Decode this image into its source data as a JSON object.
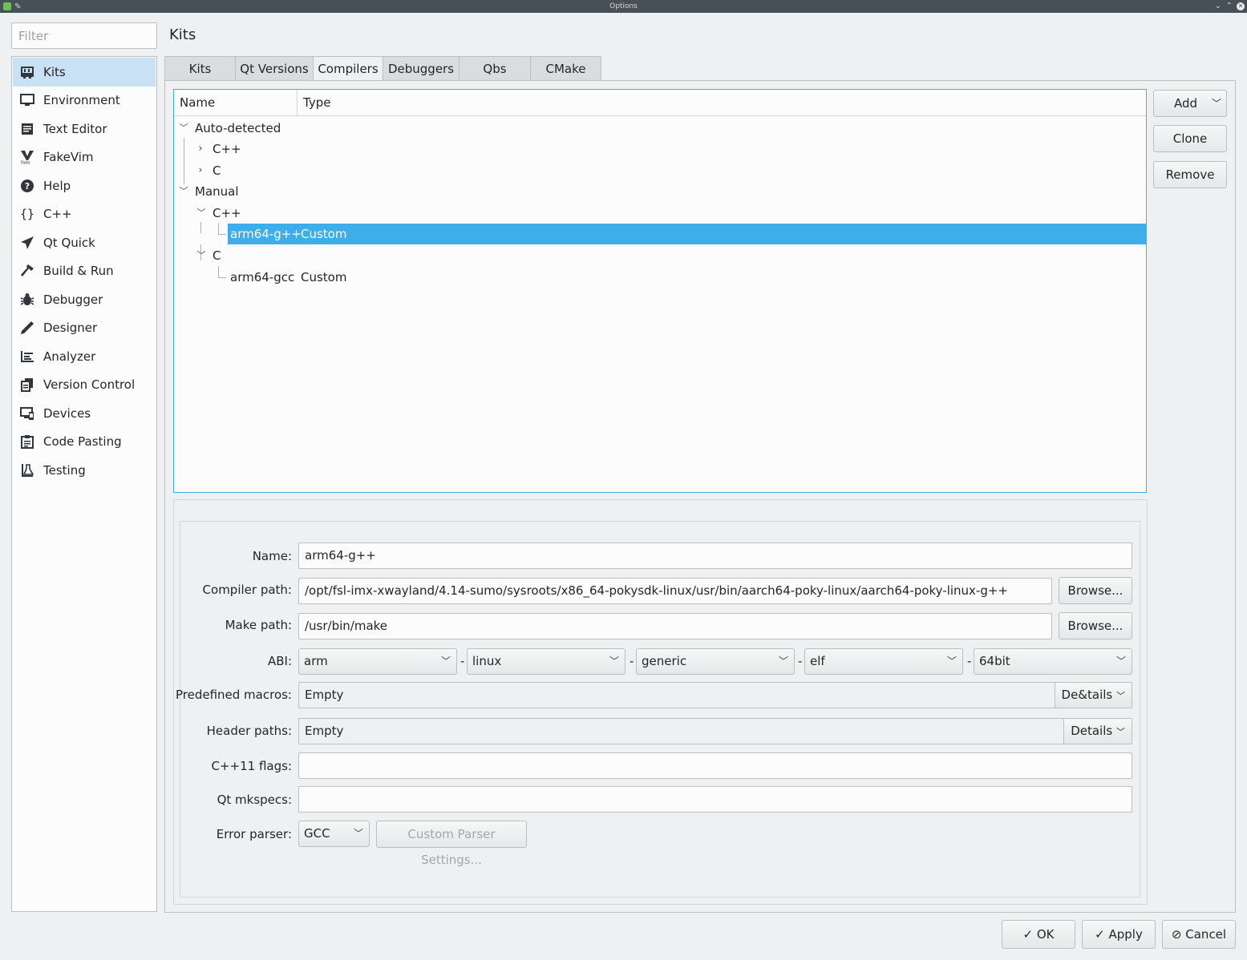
{
  "window": {
    "title": "Options"
  },
  "filter": {
    "placeholder": "Filter"
  },
  "sidebar": {
    "items": [
      {
        "label": "Kits",
        "icon": "kits-icon"
      },
      {
        "label": "Environment",
        "icon": "monitor-icon"
      },
      {
        "label": "Text Editor",
        "icon": "text-editor-icon"
      },
      {
        "label": "FakeVim",
        "icon": "fakevim-icon"
      },
      {
        "label": "Help",
        "icon": "help-icon"
      },
      {
        "label": "C++",
        "icon": "braces-icon"
      },
      {
        "label": "Qt Quick",
        "icon": "paper-plane-icon"
      },
      {
        "label": "Build & Run",
        "icon": "hammer-icon"
      },
      {
        "label": "Debugger",
        "icon": "bug-icon"
      },
      {
        "label": "Designer",
        "icon": "pencil-icon"
      },
      {
        "label": "Analyzer",
        "icon": "analyzer-icon"
      },
      {
        "label": "Version Control",
        "icon": "version-control-icon"
      },
      {
        "label": "Devices",
        "icon": "devices-icon"
      },
      {
        "label": "Code Pasting",
        "icon": "clipboard-icon"
      },
      {
        "label": "Testing",
        "icon": "flask-icon"
      }
    ]
  },
  "page": {
    "title": "Kits"
  },
  "tabs": [
    "Kits",
    "Qt Versions",
    "Compilers",
    "Debuggers",
    "Qbs",
    "CMake"
  ],
  "tree": {
    "headers": {
      "name": "Name",
      "type": "Type"
    },
    "auto_detected": "Auto-detected",
    "cpp": "C++",
    "c": "C",
    "manual": "Manual",
    "manual_cpp": "C++",
    "item1": {
      "name": "arm64-g++",
      "type": "Custom"
    },
    "manual_c": "C",
    "item2": {
      "name": "arm64-gcc",
      "type": "Custom"
    }
  },
  "side_buttons": {
    "add": "Add",
    "clone": "Clone",
    "remove": "Remove"
  },
  "form": {
    "name_label": "Name:",
    "name_value": "arm64-g++",
    "compiler_label": "Compiler path:",
    "compiler_value": "/opt/fsl-imx-xwayland/4.14-sumo/sysroots/x86_64-pokysdk-linux/usr/bin/aarch64-poky-linux/aarch64-poky-linux-g++",
    "browse": "Browse...",
    "make_label": "Make path:",
    "make_value": "/usr/bin/make",
    "abi_label": "ABI:",
    "abi": [
      "arm",
      "linux",
      "generic",
      "elf",
      "64bit"
    ],
    "abi_sep": "-",
    "macros_label": "Predefined macros:",
    "macros_value": "Empty",
    "macros_details": "De&tails",
    "header_label": "Header paths:",
    "header_value": "Empty",
    "header_details": "Details",
    "cpp11_label": "C++11 flags:",
    "cpp11_value": "",
    "mkspecs_label": "Qt mkspecs:",
    "mkspecs_value": "",
    "error_label": "Error parser:",
    "error_value": "GCC",
    "custom_parser": "Custom Parser Settings..."
  },
  "bottom": {
    "ok": "OK",
    "apply": "Apply",
    "cancel": "Cancel"
  },
  "colors": {
    "accent": "#3daee9",
    "selection_sidebar": "#c8e1f4",
    "titlebar": "#475057"
  }
}
